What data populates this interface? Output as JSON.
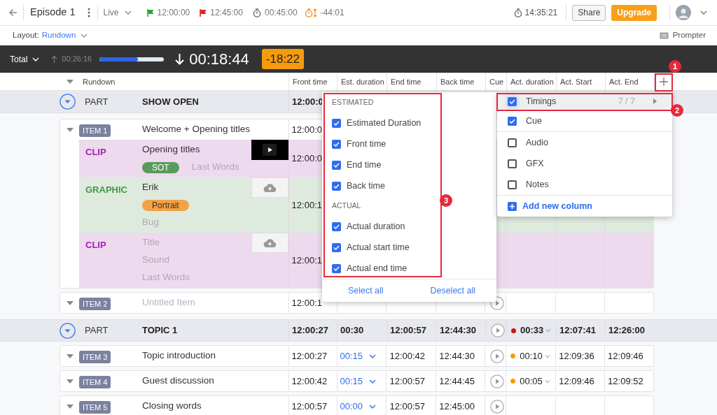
{
  "topbar": {
    "title": "Episode 1",
    "status": "Live",
    "timings": [
      {
        "kind": "start",
        "text": "12:00:00"
      },
      {
        "kind": "end",
        "text": "12:45:00"
      },
      {
        "kind": "duration",
        "text": "00:45:00"
      },
      {
        "kind": "over_under",
        "text": "-44:01"
      }
    ],
    "clock": "14:35:21",
    "share": "Share",
    "upgrade": "Upgrade"
  },
  "layout_bar": {
    "label": "Layout:",
    "value": "Rundown",
    "prompter": "Prompter"
  },
  "timer_bar": {
    "scope": "Total",
    "elapsed": "00:26:16",
    "level": 0.6,
    "remaining": "00:18:44",
    "delta": "-18:22"
  },
  "table": {
    "columns": [
      "Rundown",
      "Front time",
      "Est. duration",
      "End time",
      "Back time",
      "Cue",
      "Act. duration",
      "Act. Start",
      "Act. End"
    ],
    "rows": [
      {
        "kind": "part",
        "label": "PART",
        "title": "SHOW OPEN",
        "front": "12:00:0"
      },
      {
        "kind": "item",
        "badge": "ITEM 1",
        "title": "Welcome + Opening titles",
        "front": "12:00:0",
        "segments": [
          {
            "kind": "clip",
            "label": "CLIP",
            "media": {
              "kind": "video"
            },
            "front": "12:00:0",
            "lines": [
              [
                {
                  "text": "Opening titles"
                }
              ],
              [
                {
                  "tag": "SOT",
                  "color": "#5a9a5c"
                },
                {
                  "placeholder": "Last Words"
                }
              ]
            ]
          },
          {
            "kind": "graphic",
            "label": "GRAPHIC",
            "media": {
              "kind": "upload"
            },
            "front": "12:00:1",
            "lines": [
              [
                {
                  "text": "Erik"
                }
              ],
              [
                {
                  "tag": "Portrait",
                  "color": "#f4a144"
                }
              ],
              [
                {
                  "placeholder": "Bug"
                }
              ]
            ]
          },
          {
            "kind": "clip",
            "label": "CLIP",
            "media": {
              "kind": "upload"
            },
            "front": "12:00:1",
            "lines": [
              [
                {
                  "placeholder": "Title"
                }
              ],
              [
                {
                  "placeholder": "Sound"
                }
              ],
              [
                {
                  "placeholder": "Last Words"
                }
              ]
            ]
          }
        ]
      },
      {
        "kind": "item",
        "badge": "ITEM 2",
        "placeholder": "Untitled Item",
        "front": "12:00:1",
        "cue": true
      },
      {
        "kind": "part",
        "label": "PART",
        "title": "TOPIC 1",
        "front": "12:00:27",
        "est": "00:30",
        "end": "12:00:57",
        "back": "12:44:30",
        "cue": true,
        "act_duration": {
          "text": "00:33",
          "color": "#c8170d"
        },
        "act_start": "12:07:41",
        "act_end": "12:26:00"
      },
      {
        "kind": "item",
        "badge": "ITEM 3",
        "title": "Topic introduction",
        "front": "12:00:27",
        "est": "00:15",
        "end": "12:00:42",
        "back": "12:44:30",
        "cue": true,
        "act_duration": {
          "text": "00:10",
          "color": "#f59e0b"
        },
        "act_start": "12:09:36",
        "act_end": "12:09:46"
      },
      {
        "kind": "item",
        "badge": "ITEM 4",
        "title": "Guest discussion",
        "front": "12:00:42",
        "est": "00:15",
        "end": "12:00:57",
        "back": "12:44:45",
        "cue": true,
        "act_duration": {
          "text": "00:05",
          "color": "#f59e0b"
        },
        "act_start": "12:09:46",
        "act_end": "12:09:52"
      },
      {
        "kind": "item",
        "badge": "ITEM 5",
        "title": "Closing words",
        "front": "12:00:57",
        "est": "00:00",
        "end": "12:00:57",
        "back": "12:45:00",
        "cue": true
      }
    ]
  },
  "timing_menu": {
    "groups": [
      {
        "heading": "ESTIMATED",
        "options": [
          {
            "label": "Estimated Duration",
            "checked": true
          },
          {
            "label": "Front time",
            "checked": true
          },
          {
            "label": "End time",
            "checked": true
          },
          {
            "label": "Back time",
            "checked": true
          }
        ]
      },
      {
        "heading": "ACTUAL",
        "options": [
          {
            "label": "Actual duration",
            "checked": true
          },
          {
            "label": "Actual start time",
            "checked": true
          },
          {
            "label": "Actual end time",
            "checked": true
          }
        ]
      }
    ],
    "select_all": "Select all",
    "deselect_all": "Deselect all"
  },
  "column_menu": {
    "groups": [
      [
        {
          "label": "Timings",
          "checked": true,
          "count": "7 / 7",
          "submenu": true,
          "selected": true
        },
        {
          "label": "Cue",
          "checked": true,
          "selected": false
        }
      ],
      [
        {
          "label": "Audio",
          "checked": false,
          "selected": false
        },
        {
          "label": "GFX",
          "checked": false,
          "selected": false
        },
        {
          "label": "Notes",
          "checked": false,
          "selected": false
        }
      ]
    ],
    "add": "Add new column"
  },
  "callouts": [
    {
      "number": "1"
    },
    {
      "number": "2"
    },
    {
      "number": "3"
    }
  ]
}
